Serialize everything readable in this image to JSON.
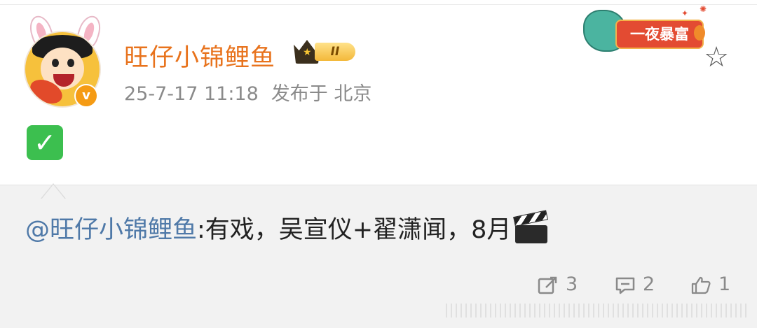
{
  "post": {
    "username": "旺仔小锦鲤鱼",
    "level_badge": "II",
    "timestamp": "25-7-17 11:18",
    "publish_location": "发布于 北京",
    "avatar_verified": "v",
    "body_emoji": "✓"
  },
  "banner": {
    "label": "一夜暴富"
  },
  "quote": {
    "mention": "@旺仔小锦鲤鱼",
    "text": ":有戏，吴宣仪+翟潇闻，8月"
  },
  "actions": {
    "share_count": "3",
    "comment_count": "2",
    "like_count": "1"
  },
  "icons": {
    "star": "star-outline-icon",
    "share": "share-icon",
    "comment": "comment-icon",
    "like": "thumbs-up-icon",
    "clapper": "clapperboard-icon",
    "check": "check-mark-emoji"
  },
  "colors": {
    "username": "#e8731d",
    "mention": "#4f79a8",
    "meta": "#8a8a8a",
    "banner": "#e34b32",
    "check": "#3cbf4f"
  }
}
